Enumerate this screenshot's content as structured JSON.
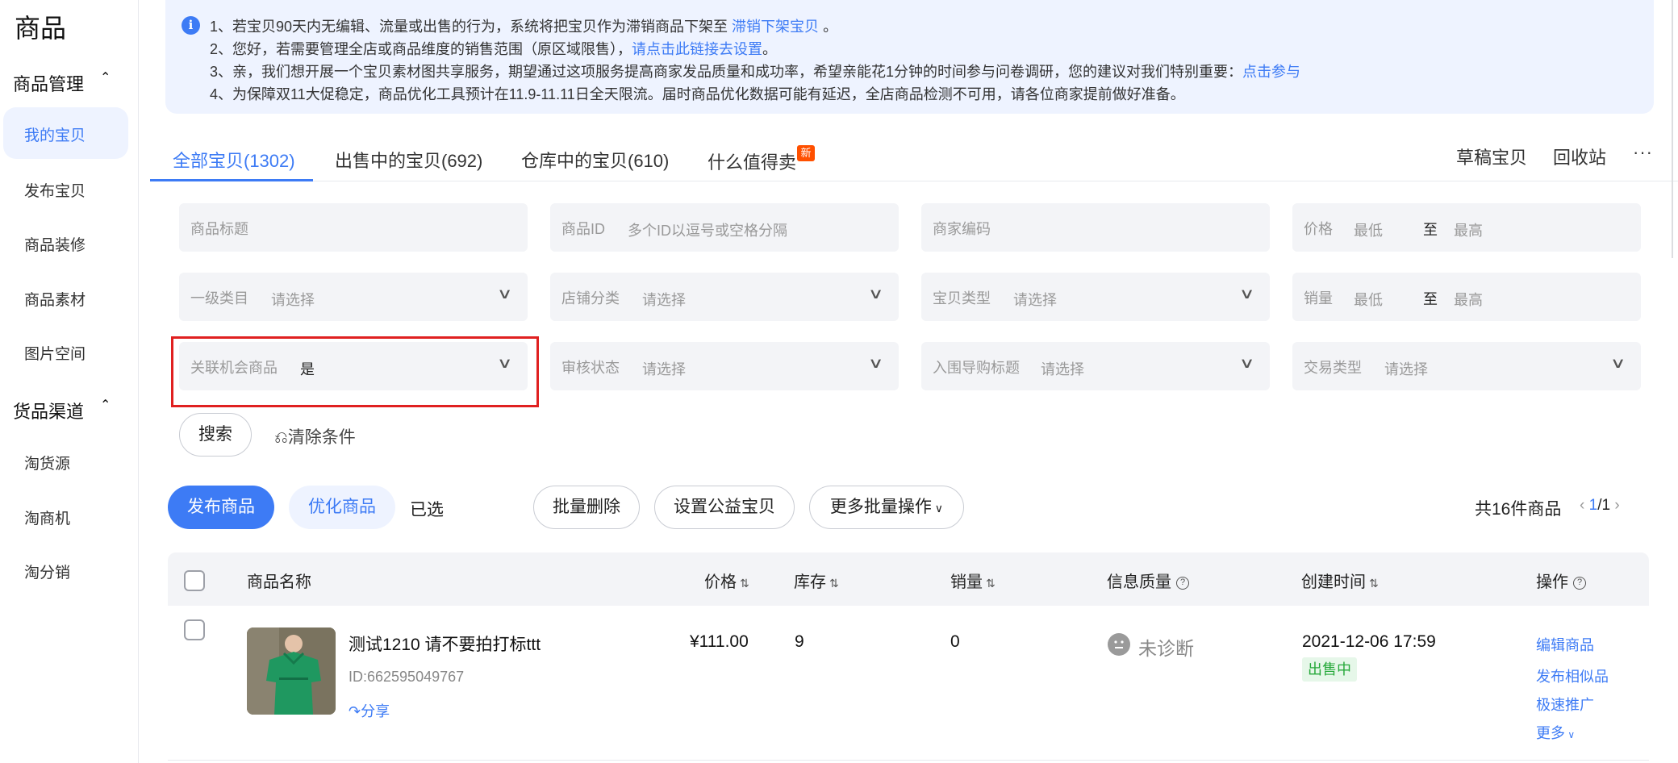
{
  "sidebar": {
    "title": "商品",
    "sections": [
      {
        "label": "商品管理",
        "items": [
          "我的宝贝",
          "发布宝贝",
          "商品装修",
          "商品素材",
          "图片空间"
        ]
      },
      {
        "label": "货品渠道",
        "items": [
          "淘货源",
          "淘商机",
          "淘分销"
        ]
      }
    ],
    "active_item": "我的宝贝"
  },
  "notice": {
    "line1_text": "1、若宝贝90天内无编辑、流量或出售的行为，系统将把宝贝作为滞销商品下架至",
    "line1_link": "滞销下架宝贝",
    "line1_end": "。",
    "line2_text": "2、您好，若需要管理全店或商品维度的销售范围（原区域限售），",
    "line2_link": "请点击此链接去设置",
    "line2_end": "。",
    "line3_text": "3、亲，我们想开展一个宝贝素材图共享服务，期望通过这项服务提高商家发品质量和成功率，希望亲能花1分钟的时间参与问卷调研，您的建议对我们特别重要：",
    "line3_link": "点击参与",
    "line4_text": "4、为保障双11大促稳定，商品优化工具预计在11.9-11.11日全天限流。届时商品优化数据可能有延迟，全店商品检测不可用，请各位商家提前做好准备。"
  },
  "tabs": {
    "items": [
      "全部宝贝(1302)",
      "出售中的宝贝(692)",
      "仓库中的宝贝(610)",
      "什么值得卖"
    ],
    "active": "全部宝贝(1302)",
    "new_badge": "新",
    "right_links": [
      "草稿宝贝",
      "回收站"
    ],
    "more": "···"
  },
  "filters": {
    "title_placeholder": "商品标题",
    "id_label": "商品ID",
    "id_placeholder": "多个ID以逗号或空格分隔",
    "code_placeholder": "商家编码",
    "price_label": "价格",
    "min": "最低",
    "to": "至",
    "max": "最高",
    "cat_label": "一级类目",
    "shop_cat_label": "店铺分类",
    "type_label": "宝贝类型",
    "sales_label": "销量",
    "select_placeholder": "请选择",
    "opp_label": "关联机会商品",
    "opp_value": "是",
    "audit_label": "审核状态",
    "guide_label": "入围导购标题",
    "trade_label": "交易类型",
    "search_btn": "搜索",
    "clear_btn": "清除条件"
  },
  "actions": {
    "publish": "发布商品",
    "optimize": "优化商品",
    "selected": "已选",
    "batch_delete": "批量删除",
    "charity": "设置公益宝贝",
    "more_batch": "更多批量操作",
    "total": "共16件商品",
    "page_current": "1",
    "page_total": "/1"
  },
  "table": {
    "headers": [
      "商品名称",
      "价格",
      "库存",
      "销量",
      "信息质量",
      "创建时间",
      "操作"
    ],
    "rows": [
      {
        "name": "测试1210 请不要拍打标ttt",
        "id": "ID:662595049767",
        "share": "分享",
        "price": "¥111.00",
        "stock": "9",
        "sales": "0",
        "quality": "未诊断",
        "created": "2021-12-06 17:59",
        "status": "出售中",
        "ops": [
          "编辑商品",
          "发布相似品",
          "极速推广",
          "更多"
        ]
      }
    ]
  },
  "colors": {
    "accent": "#3d7bf5",
    "highlight": "#e02020",
    "status_green": "#26a93a"
  }
}
